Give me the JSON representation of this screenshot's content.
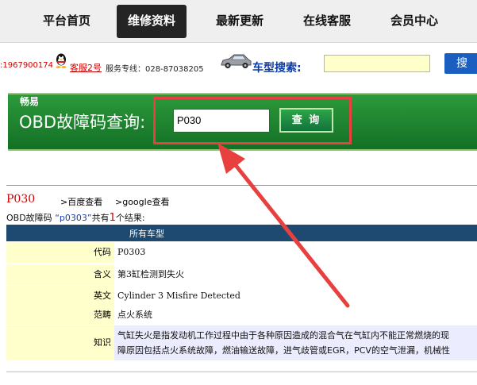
{
  "nav": {
    "items": [
      {
        "label": "平台首页"
      },
      {
        "label": "维修资料",
        "active": true
      },
      {
        "label": "最新更新"
      },
      {
        "label": "在线客服"
      },
      {
        "label": "会员中心"
      }
    ]
  },
  "contact": {
    "qq_number": ":1967900174",
    "kefu_link": "客服2号",
    "service_line": "服务专线：028-87038205"
  },
  "search": {
    "label": "车型搜索:",
    "value": "",
    "button_label": "搜"
  },
  "banner": {
    "brand": "畅易",
    "title": "OBD故障码查询:",
    "input_value": "P030",
    "query_button": "查 询"
  },
  "result": {
    "code": "P030",
    "link_baidu": ">百度查看",
    "link_google": ">google查看",
    "summary_prefix": "OBD故障码",
    "summary_query": "“p0303”",
    "summary_mid": "共有",
    "summary_count": "1",
    "summary_suffix": "个结果:",
    "table_header": "所有车型",
    "rows": [
      {
        "label": "代码",
        "value": "P0303"
      },
      {
        "label": "含义",
        "value": "第3缸检测到失火"
      },
      {
        "label": "英文",
        "value": "Cylinder 3 Misfire Detected"
      },
      {
        "label": "范畴",
        "value": "点火系统"
      },
      {
        "label": "知识",
        "value_line1": "气缸失火是指发动机工作过程中由于各种原因造成的混合气在气缸内不能正常燃烧的现",
        "value_line2": "障原因包括点火系统故障，燃油输送故障，进气歧管或EGR，PCV的空气泄漏，机械性"
      }
    ]
  },
  "colors": {
    "nav_active": "#242424",
    "banner_green": "#1c8a30",
    "highlight_red": "#e8403e",
    "table_header": "#1e4a72",
    "label_bg": "#ffffcc",
    "knowledge_bg": "#ececff"
  }
}
